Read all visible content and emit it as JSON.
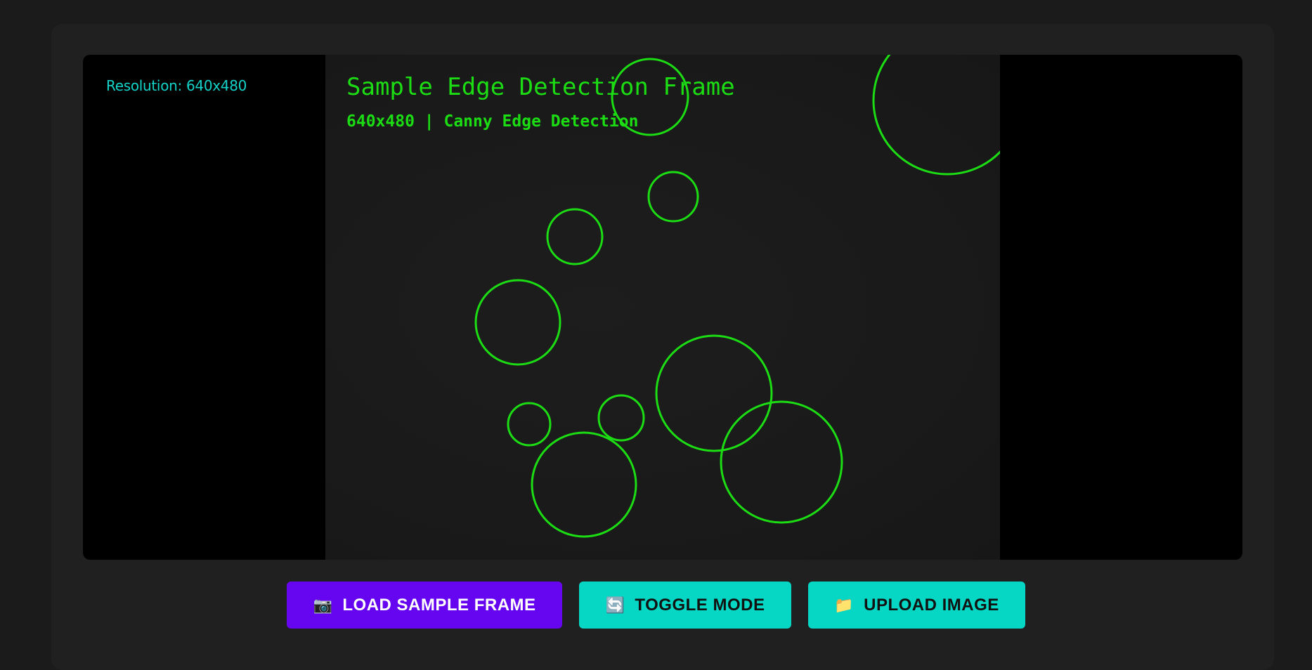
{
  "viewer": {
    "resolution_label": "Resolution: 640x480",
    "frame_title": "Sample Edge Detection Frame",
    "frame_subtitle": "640x480 | Canny Edge Detection",
    "edge_color": "#1cdc14"
  },
  "controls": {
    "load_sample": {
      "icon": "📷",
      "label": "LOAD SAMPLE FRAME"
    },
    "toggle_mode": {
      "icon": "🔄",
      "label": "TOGGLE MODE"
    },
    "upload_image": {
      "icon": "📁",
      "label": "UPLOAD IMAGE"
    }
  },
  "colors": {
    "background": "#1b1b1b",
    "panel": "#202020",
    "accent_purple": "#6605ef",
    "accent_teal": "#06d6c4",
    "resolution_text": "#14d3c8"
  }
}
